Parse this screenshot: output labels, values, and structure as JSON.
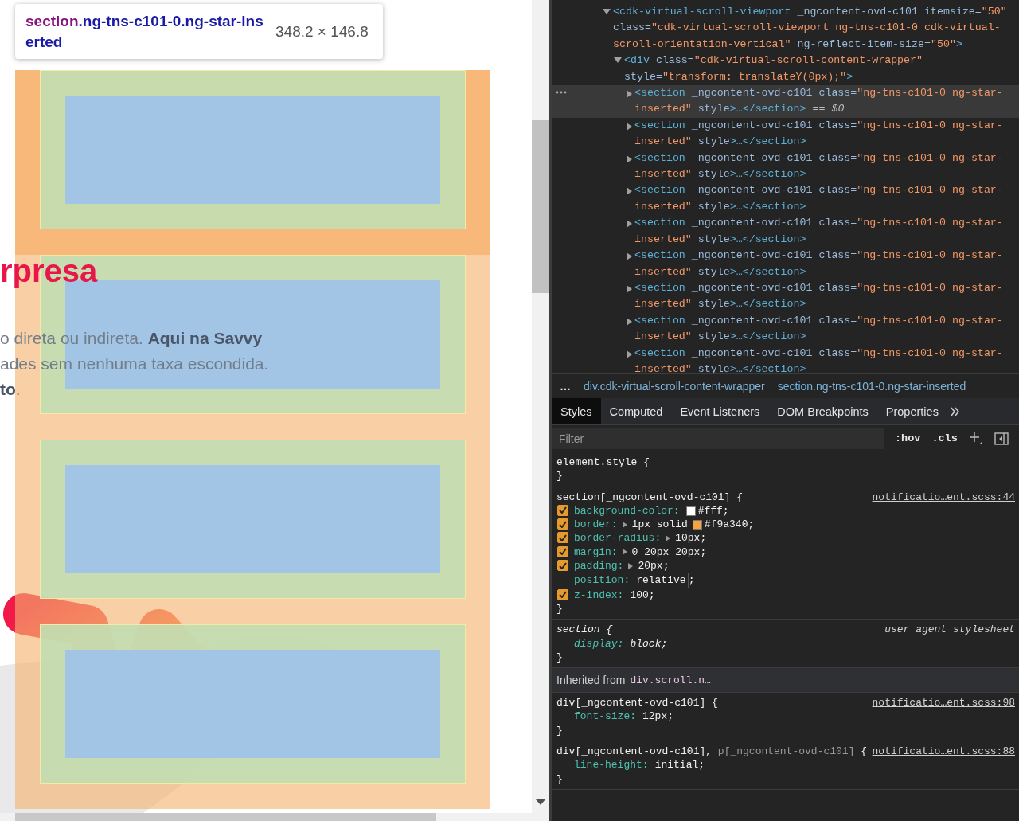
{
  "page": {
    "heading": "rpresa",
    "paragraph_lines": [
      "o direta ou indireta. **Aqui na Savvy**",
      "ades sem nenhuma taxa escondida.",
      "**to**."
    ]
  },
  "highlight": {
    "tooltip": {
      "tag": "section",
      "classes": ".ng-tns-c101-0.ng-star-inserted",
      "size": "348.2 × 146.8"
    },
    "boxes": [
      {
        "selected": true
      },
      {
        "selected": false
      },
      {
        "selected": false
      },
      {
        "selected": false
      }
    ]
  },
  "devtools": {
    "dom_tree": [
      {
        "expanded": true,
        "selected": false,
        "segments": [
          {
            "kind": "tag",
            "text": "<cdk-virtual-scroll-viewport"
          },
          {
            "kind": "attr",
            "text": " _ngcontent-ovd-c101"
          },
          {
            "kind": "attr",
            "text": " itemsize="
          },
          {
            "kind": "value",
            "text": "\"50\""
          },
          {
            "kind": "attr",
            "text": " class="
          },
          {
            "kind": "value",
            "text": "\"cdk-virtual-scroll-viewport ng-tns-c101-0 cdk-virtual-scroll-orientation-vertical\""
          },
          {
            "kind": "attr",
            "text": " ng-reflect-item-size="
          },
          {
            "kind": "value",
            "text": "\"50\""
          },
          {
            "kind": "tag",
            "text": ">"
          }
        ],
        "children": [
          {
            "expanded": true,
            "selected": false,
            "segments": [
              {
                "kind": "tag",
                "text": "<div"
              },
              {
                "kind": "attr",
                "text": " class="
              },
              {
                "kind": "value",
                "text": "\"cdk-virtual-scroll-content-wrapper\""
              },
              {
                "kind": "attr",
                "text": " style="
              },
              {
                "kind": "value",
                "text": "\"transform: translateY(0px);\""
              },
              {
                "kind": "tag",
                "text": ">"
              }
            ],
            "children": [
              {
                "expanded": false,
                "selected": true,
                "segments": [
                  {
                    "kind": "tag",
                    "text": "<section"
                  },
                  {
                    "kind": "attr",
                    "text": " _ngcontent-ovd-c101"
                  },
                  {
                    "kind": "attr",
                    "text": " class="
                  },
                  {
                    "kind": "value",
                    "text": "\"ng-tns-c101-0 ng-star-inserted\""
                  },
                  {
                    "kind": "attr",
                    "text": " style"
                  },
                  {
                    "kind": "tag",
                    "text": ">…</section>"
                  },
                  {
                    "kind": "ref",
                    "text": " == $0"
                  }
                ]
              },
              {
                "expanded": false,
                "selected": false,
                "segments": [
                  {
                    "kind": "tag",
                    "text": "<section"
                  },
                  {
                    "kind": "attr",
                    "text": " _ngcontent-ovd-c101"
                  },
                  {
                    "kind": "attr",
                    "text": " class="
                  },
                  {
                    "kind": "value",
                    "text": "\"ng-tns-c101-0 ng-star-inserted\""
                  },
                  {
                    "kind": "attr",
                    "text": " style"
                  },
                  {
                    "kind": "tag",
                    "text": ">…</section>"
                  }
                ]
              },
              {
                "expanded": false,
                "selected": false,
                "segments": [
                  {
                    "kind": "tag",
                    "text": "<section"
                  },
                  {
                    "kind": "attr",
                    "text": " _ngcontent-ovd-c101"
                  },
                  {
                    "kind": "attr",
                    "text": " class="
                  },
                  {
                    "kind": "value",
                    "text": "\"ng-tns-c101-0 ng-star-inserted\""
                  },
                  {
                    "kind": "attr",
                    "text": " style"
                  },
                  {
                    "kind": "tag",
                    "text": ">…</section>"
                  }
                ]
              },
              {
                "expanded": false,
                "selected": false,
                "segments": [
                  {
                    "kind": "tag",
                    "text": "<section"
                  },
                  {
                    "kind": "attr",
                    "text": " _ngcontent-ovd-c101"
                  },
                  {
                    "kind": "attr",
                    "text": " class="
                  },
                  {
                    "kind": "value",
                    "text": "\"ng-tns-c101-0 ng-star-inserted\""
                  },
                  {
                    "kind": "attr",
                    "text": " style"
                  },
                  {
                    "kind": "tag",
                    "text": ">…</section>"
                  }
                ]
              },
              {
                "expanded": false,
                "selected": false,
                "segments": [
                  {
                    "kind": "tag",
                    "text": "<section"
                  },
                  {
                    "kind": "attr",
                    "text": " _ngcontent-ovd-c101"
                  },
                  {
                    "kind": "attr",
                    "text": " class="
                  },
                  {
                    "kind": "value",
                    "text": "\"ng-tns-c101-0 ng-star-inserted\""
                  },
                  {
                    "kind": "attr",
                    "text": " style"
                  },
                  {
                    "kind": "tag",
                    "text": ">…</section>"
                  }
                ]
              },
              {
                "expanded": false,
                "selected": false,
                "segments": [
                  {
                    "kind": "tag",
                    "text": "<section"
                  },
                  {
                    "kind": "attr",
                    "text": " _ngcontent-ovd-c101"
                  },
                  {
                    "kind": "attr",
                    "text": " class="
                  },
                  {
                    "kind": "value",
                    "text": "\"ng-tns-c101-0 ng-star-inserted\""
                  },
                  {
                    "kind": "attr",
                    "text": " style"
                  },
                  {
                    "kind": "tag",
                    "text": ">…</section>"
                  }
                ]
              },
              {
                "expanded": false,
                "selected": false,
                "segments": [
                  {
                    "kind": "tag",
                    "text": "<section"
                  },
                  {
                    "kind": "attr",
                    "text": " _ngcontent-ovd-c101"
                  },
                  {
                    "kind": "attr",
                    "text": " class="
                  },
                  {
                    "kind": "value",
                    "text": "\"ng-tns-c101-0 ng-star-inserted\""
                  },
                  {
                    "kind": "attr",
                    "text": " style"
                  },
                  {
                    "kind": "tag",
                    "text": ">…</section>"
                  }
                ]
              },
              {
                "expanded": false,
                "selected": false,
                "segments": [
                  {
                    "kind": "tag",
                    "text": "<section"
                  },
                  {
                    "kind": "attr",
                    "text": " _ngcontent-ovd-c101"
                  },
                  {
                    "kind": "attr",
                    "text": " class="
                  },
                  {
                    "kind": "value",
                    "text": "\"ng-tns-c101-0 ng-star-inserted\""
                  },
                  {
                    "kind": "attr",
                    "text": " style"
                  },
                  {
                    "kind": "tag",
                    "text": ">…</section>"
                  }
                ]
              },
              {
                "expanded": false,
                "selected": false,
                "segments": [
                  {
                    "kind": "tag",
                    "text": "<section"
                  },
                  {
                    "kind": "attr",
                    "text": " _ngcontent-ovd-c101"
                  },
                  {
                    "kind": "attr",
                    "text": " class="
                  },
                  {
                    "kind": "value",
                    "text": "\"ng-tns-c101-0 ng-star-inserted\""
                  },
                  {
                    "kind": "attr",
                    "text": " style"
                  },
                  {
                    "kind": "tag",
                    "text": ">…</section>"
                  }
                ]
              }
            ]
          }
        ]
      }
    ],
    "breadcrumb": [
      {
        "tag": "…"
      },
      {
        "tag": "div",
        "rest": ".cdk-virtual-scroll-content-wrapper"
      },
      {
        "tag": "section",
        "rest": ".ng-tns-c101-0.ng-star-inserted"
      }
    ],
    "tabs": [
      {
        "label": "Styles",
        "selected": true
      },
      {
        "label": "Computed",
        "selected": false
      },
      {
        "label": "Event Listeners",
        "selected": false
      },
      {
        "label": "DOM Breakpoints",
        "selected": false
      },
      {
        "label": "Properties",
        "selected": false
      }
    ],
    "filter": {
      "placeholder": "Filter"
    },
    "filter_buttons": [
      ":hov",
      ".cls"
    ],
    "rules": [
      {
        "kind": "rule",
        "selector": [
          {
            "text": "element.style {",
            "matched": true
          }
        ],
        "close": "}"
      },
      {
        "kind": "rule",
        "selector": [
          {
            "text": "section[_ngcontent-ovd-c101] {",
            "matched": true
          }
        ],
        "source": "notificatio…ent.scss:44",
        "declarations": [
          {
            "name": "background-color:",
            "color": "#ffffff",
            "value": "#fff;",
            "checked": true
          },
          {
            "name": "border:",
            "expandable": true,
            "prefix": "1px solid",
            "color": "#f9a340",
            "value": "#f9a340;",
            "checked": true
          },
          {
            "name": "border-radius:",
            "expandable": true,
            "value": "10px;",
            "checked": true
          },
          {
            "name": "margin:",
            "expandable": true,
            "value": "0 20px 20px;",
            "checked": true
          },
          {
            "name": "padding:",
            "expandable": true,
            "value": "20px;",
            "checked": true
          },
          {
            "name": "position:",
            "value": "relative",
            "editing": true,
            "after": ";"
          },
          {
            "name": "z-index:",
            "value": "100;",
            "checked": true
          }
        ],
        "close": "}"
      },
      {
        "kind": "useragent",
        "selector": [
          {
            "text": "section {",
            "matched": true
          }
        ],
        "source": "user agent stylesheet",
        "declarations": [
          {
            "name": "display:",
            "value": "block;"
          }
        ],
        "close": "}"
      },
      {
        "kind": "inherited",
        "label": "Inherited from",
        "from": "div.scroll.n…"
      },
      {
        "kind": "rule",
        "selector": [
          {
            "text": "div[_ngcontent-ovd-c101] {",
            "matched": true
          }
        ],
        "source": "notificatio…ent.scss:98",
        "declarations": [
          {
            "name": "font-size:",
            "value": "12px;"
          }
        ],
        "close": "}"
      },
      {
        "kind": "rule",
        "selector": [
          {
            "text": "div[_ngcontent-ovd-c101],",
            "matched": true
          },
          {
            "text": " p[_ngcontent-ovd-c101]",
            "matched": false
          },
          {
            "text": " {",
            "matched": true
          }
        ],
        "source": "notificatio…ent.scss:88",
        "declarations": [
          {
            "name": "line-height:",
            "value": "initial;"
          }
        ],
        "close": "}"
      }
    ]
  }
}
